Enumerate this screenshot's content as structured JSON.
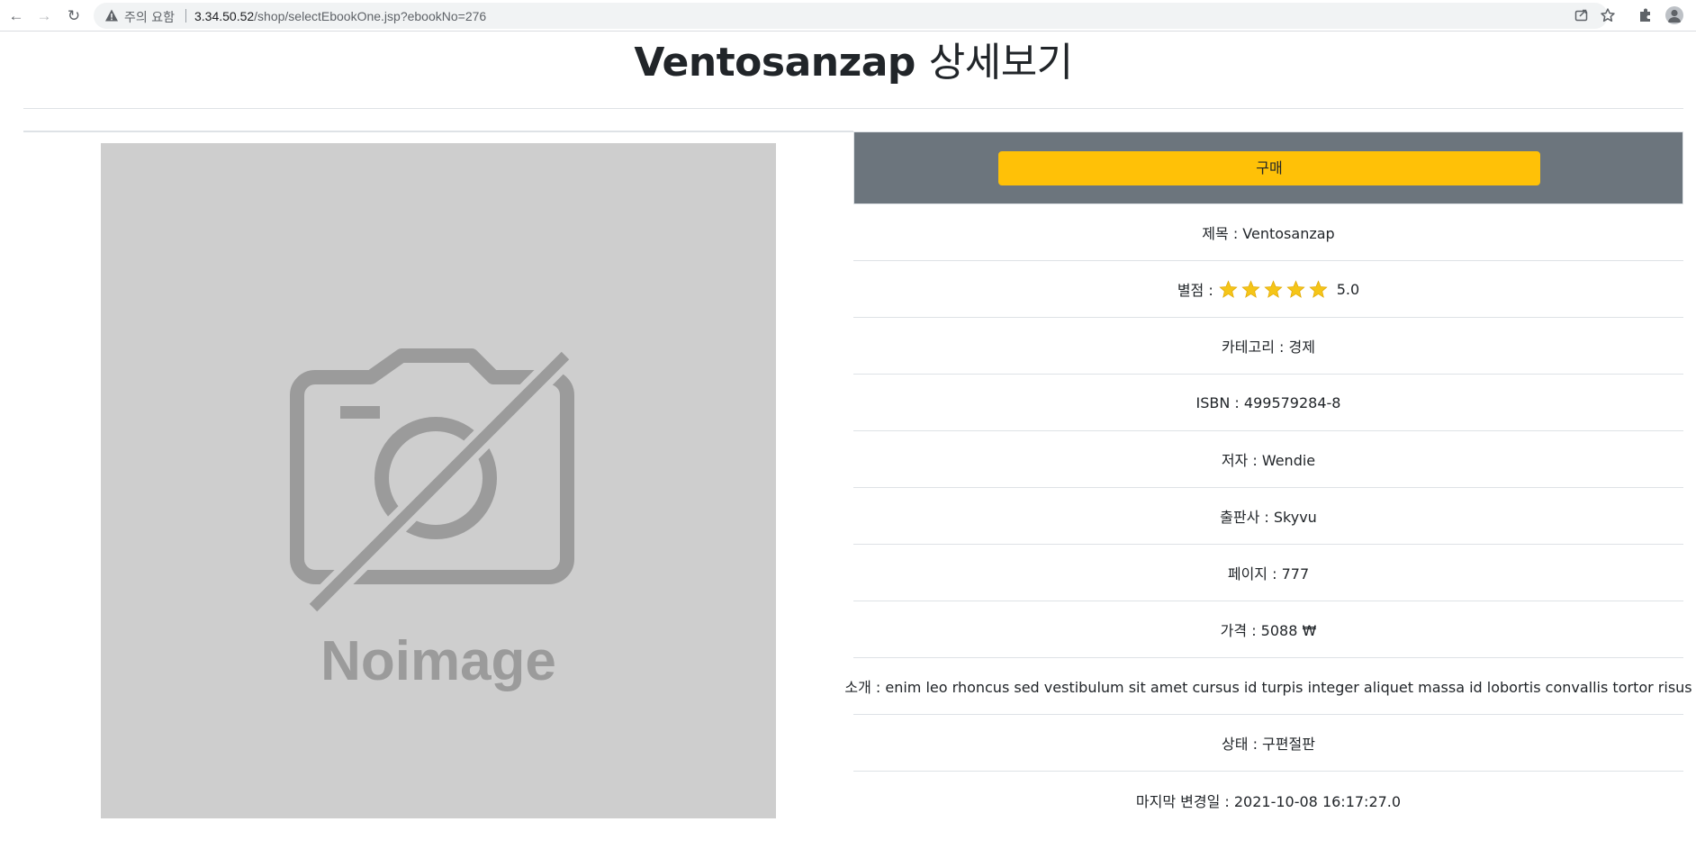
{
  "browser": {
    "security_warning": "주의 요함",
    "url_host": "3.34.50.52",
    "url_path": "/shop/selectEbookOne.jsp?ebookNo=276"
  },
  "page": {
    "title_name": "Ventosanzap",
    "title_suffix": "상세보기"
  },
  "cover": {
    "placeholder_text": "Noimage"
  },
  "buy_button_label": "구매",
  "details": {
    "title": "제목 : Ventosanzap",
    "rating_label": "별점 :",
    "rating_value": "5.0",
    "rating_stars": 5,
    "category": "카테고리 : 경제",
    "isbn": "ISBN : 499579284-8",
    "author": "저자 : Wendie",
    "publisher": "출판사 : Skyvu",
    "pages": "페이지 : 777",
    "price": "가격 : 5088 ₩",
    "summary": "소개 : enim leo rhoncus sed vestibulum sit amet cursus id turpis integer aliquet massa id lobortis convallis tortor risus",
    "status": "상태 : 구편절판",
    "updated": "마지막 변경일 : 2021-10-08 16:17:27.0"
  },
  "colors": {
    "buy_button": "#ffc107",
    "buy_row_bg": "#6c757d",
    "star": "#f5c518",
    "cover_bg": "#cecece"
  }
}
